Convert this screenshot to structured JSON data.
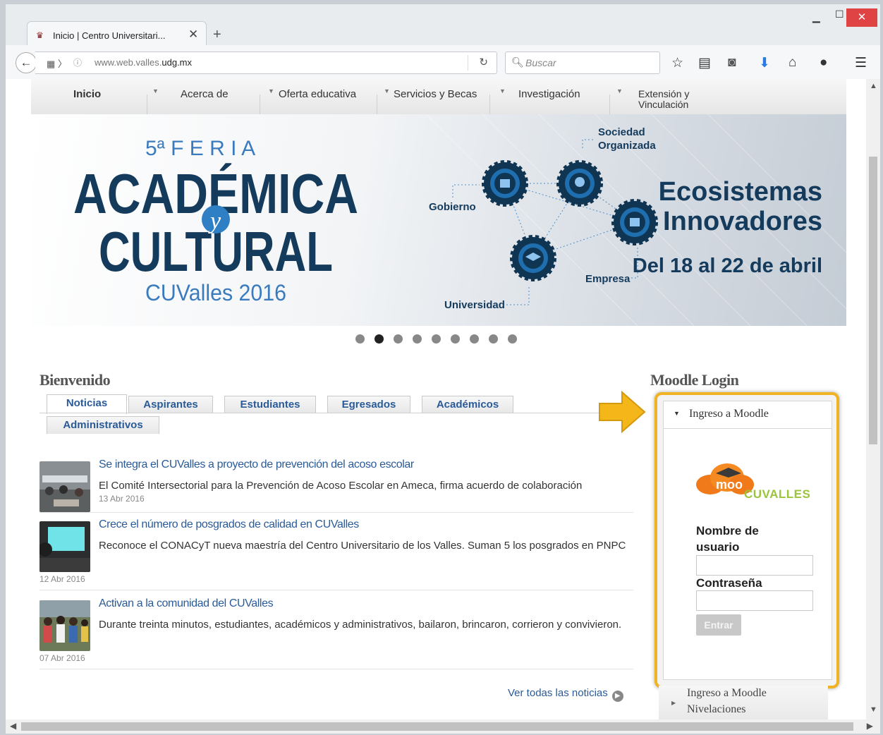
{
  "browser": {
    "tab_title": "Inicio | Centro Universitari...",
    "tab_close": "✕",
    "new_tab": "+",
    "url_domain": "www.web.valles.",
    "url_host_bold": "udg.mx",
    "search_placeholder": "Buscar"
  },
  "site_menu": {
    "items": [
      "Inicio",
      "Acerca de",
      "Oferta educativa",
      "Servicios y Becas",
      "Investigación",
      "Extensión y Vinculación"
    ]
  },
  "banner": {
    "feria": "5ª  F E R I A",
    "academica": "ACADÉMICA",
    "y": "y",
    "cultural": "CULTURAL",
    "cuvalles": "CUValles 2016",
    "nodes": [
      "Sociedad",
      "Organizada",
      "Gobierno",
      "Universidad",
      "Empresa"
    ],
    "headline1": "Ecosistemas",
    "headline2": "Innovadores",
    "dates": "Del 18 al 22 de abril",
    "slide_count": 9,
    "active_slide": 2
  },
  "welcome": {
    "title": "Bienvenido",
    "tabs": [
      "Noticias",
      "Aspirantes",
      "Estudiantes",
      "Egresados",
      "Académicos",
      "Administrativos"
    ],
    "active_tab": "Noticias",
    "news": [
      {
        "title": "Se integra el CUValles a proyecto de prevención del acoso escolar",
        "desc": "El Comité Intersectorial para la Prevención de Acoso Escolar en Ameca, firma acuerdo de colaboración",
        "date": "13 Abr 2016"
      },
      {
        "title": "Crece el número de posgrados de calidad en CUValles",
        "desc": "Reconoce el CONACyT nueva maestría del Centro Universitario de los Valles. Suman 5 los posgrados en PNPC",
        "date": "12 Abr 2016"
      },
      {
        "title": "Activan a la comunidad del CUValles",
        "desc": "Durante treinta minutos, estudiantes, académicos y administrativos, bailaron, brincaron, corrieron y convivieron.",
        "date": "07 Abr 2016"
      }
    ],
    "more_news": "Ver todas las noticias"
  },
  "moodle": {
    "title": "Moodle Login",
    "block_title": "Ingreso a Moodle",
    "logo_text": "CUVALLES",
    "logo_word": "moo",
    "username_label": "Nombre de usuario",
    "password_label": "Contraseña",
    "username_value": "",
    "password_value": "",
    "submit": "Entrar",
    "links": [
      "Ingreso a Moodle",
      "Nivelaciones"
    ]
  },
  "colors": {
    "link_blue": "#2a5b99",
    "banner_navy": "#143a5c",
    "banner_blue": "#3a7bbf",
    "highlight_gold": "#f0b323",
    "moodle_orange": "#f07a1a",
    "moodle_green": "#9bc33c"
  }
}
